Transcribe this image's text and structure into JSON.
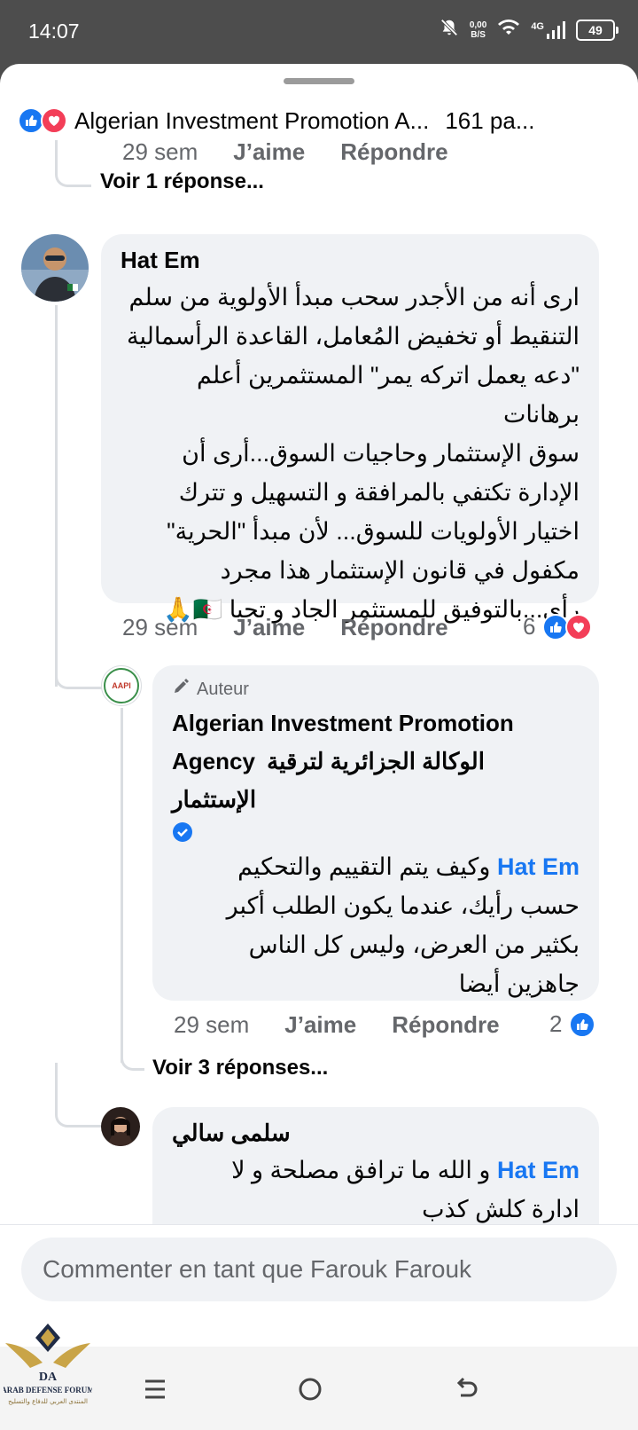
{
  "status_bar": {
    "time": "14:07",
    "speed_top": "0,00",
    "speed_bottom": "B/S",
    "network": "4G",
    "battery": "49"
  },
  "header": {
    "title": "Algerian Investment Promotion A...",
    "reactions": "161 pa..."
  },
  "comments": [
    {
      "age": "29 sem",
      "like_label": "J’aime",
      "reply_label": "Répondre",
      "more_replies": "Voir 1 réponse..."
    },
    {
      "author": "Hat Em",
      "lines": [
        "ارى أنه من الأجدر سحب مبدأ الأولوية من سلم",
        "التنقيط أو تخفيض المُعامل، القاعدة الرأسمالية",
        "\"دعه يعمل اتركه يمر\" المستثمرين أعلم برهانات",
        "سوق الإستثمار وحاجيات السوق...أرى أن",
        "الإدارة تكتفي بالمرافقة و التسهيل و تترك",
        "اختيار الأولويات للسوق... لأن  مبدأ \"الحرية\"",
        "مكفول في قانون الإستثمار هذا مجرد",
        "رأي...بالتوفيق للمستثمر الجاد و تحيا 🇩🇿🙏"
      ],
      "age": "29 sem",
      "like_label": "J’aime",
      "reply_label": "Répondre",
      "reaction_count": "6"
    },
    {
      "author_badge": "Auteur",
      "author_line1": "Algerian Investment Promotion",
      "author_line2_en": "Agency",
      "author_line2_ar": "الوكالة الجزائرية لترقية",
      "author_line3_ar": "الإستثمار",
      "logo_text": "AAPI",
      "mention": "Hat Em",
      "first_line": "وكيف يتم التقييم والتحكيم",
      "lines": [
        "حسب رأيك،  عندما يكون الطلب أكبر",
        "بكثير من العرض،  وليس كل الناس",
        "جاهزين أيضا"
      ],
      "age": "29 sem",
      "like_label": "J’aime",
      "reply_label": "Répondre",
      "reaction_count": "2",
      "more_replies": "Voir 3 réponses..."
    },
    {
      "author": "سلمى سالي",
      "mention": "Hat Em",
      "first_line": "و الله ما ترافق مصلحة و لا",
      "second_line": "ادارة كلش كذب"
    }
  ],
  "composer": {
    "placeholder": "Commenter en tant que Farouk Farouk"
  },
  "watermark": {
    "monogram": "DA",
    "title": "ARAB DEFENSE FORUM",
    "subtitle": "المنتدى العربي للدفاع والتسليح"
  },
  "colors": {
    "facebook_blue": "#1877f2",
    "love_red": "#f33e58",
    "bubble": "#f0f2f5"
  }
}
